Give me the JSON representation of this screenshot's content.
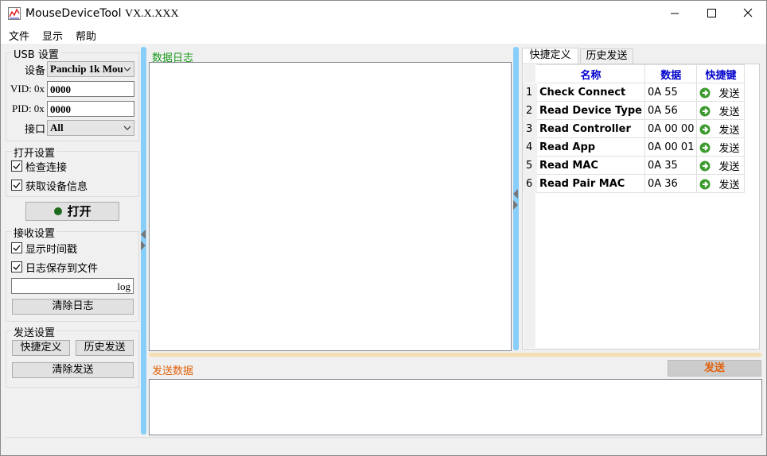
{
  "window": {
    "title_main": "MouseDeviceTool ",
    "title_version": "VX.X.XXX",
    "minimize_glyph": "—",
    "maximize_glyph": "☐",
    "close_glyph": "✕"
  },
  "menu": [
    "文件",
    "显示",
    "帮助"
  ],
  "usb": {
    "title": "USB 设置",
    "device_label": "设备",
    "device_value": "Panchip 1k Mou",
    "vid_label": "VID: 0x",
    "vid_value": "0000",
    "pid_label": "PID: 0x",
    "pid_value": "0000",
    "port_label": "接口",
    "port_value": "All"
  },
  "open_settings": {
    "title": "打开设置",
    "check_connect": "检查连接",
    "get_device_info": "获取设备信息",
    "open_button": "打开",
    "status_color": "#1e6b1e"
  },
  "receive": {
    "title": "接收设置",
    "show_timestamp": "显示时间戳",
    "save_to_file": "日志保存到文件",
    "file_name": "log",
    "clear_log": "清除日志"
  },
  "send_settings": {
    "title": "发送设置",
    "shortcut_button": "快捷定义",
    "history_button": "历史发送",
    "clear_send": "清除发送"
  },
  "log": {
    "title": "数据日志",
    "title_color": "#1a9a1a"
  },
  "send": {
    "title": "发送数据",
    "title_color": "#e0600a",
    "button": "发送"
  },
  "tabs": [
    "快捷定义",
    "历史发送"
  ],
  "shortcut_table": {
    "headers": [
      "名称",
      "数据",
      "快捷键"
    ],
    "header_color": "#0000cc",
    "rows": [
      {
        "index": "1",
        "name": "Check Connect",
        "data": "0A 55",
        "send": "发送"
      },
      {
        "index": "2",
        "name": "Read Device Type",
        "data": "0A 56",
        "send": "发送"
      },
      {
        "index": "3",
        "name": "Read Controller",
        "data": "0A 00 00",
        "send": "发送"
      },
      {
        "index": "4",
        "name": "Read App",
        "data": "0A 00 01",
        "send": "发送"
      },
      {
        "index": "5",
        "name": "Read MAC",
        "data": "0A 35",
        "send": "发送"
      },
      {
        "index": "6",
        "name": "Read Pair MAC",
        "data": "0A 36",
        "send": "发送"
      }
    ]
  },
  "icons": {
    "send_row": "arrow-right-circle-icon",
    "app": "chart-app-icon",
    "check": "checkmark-icon"
  }
}
